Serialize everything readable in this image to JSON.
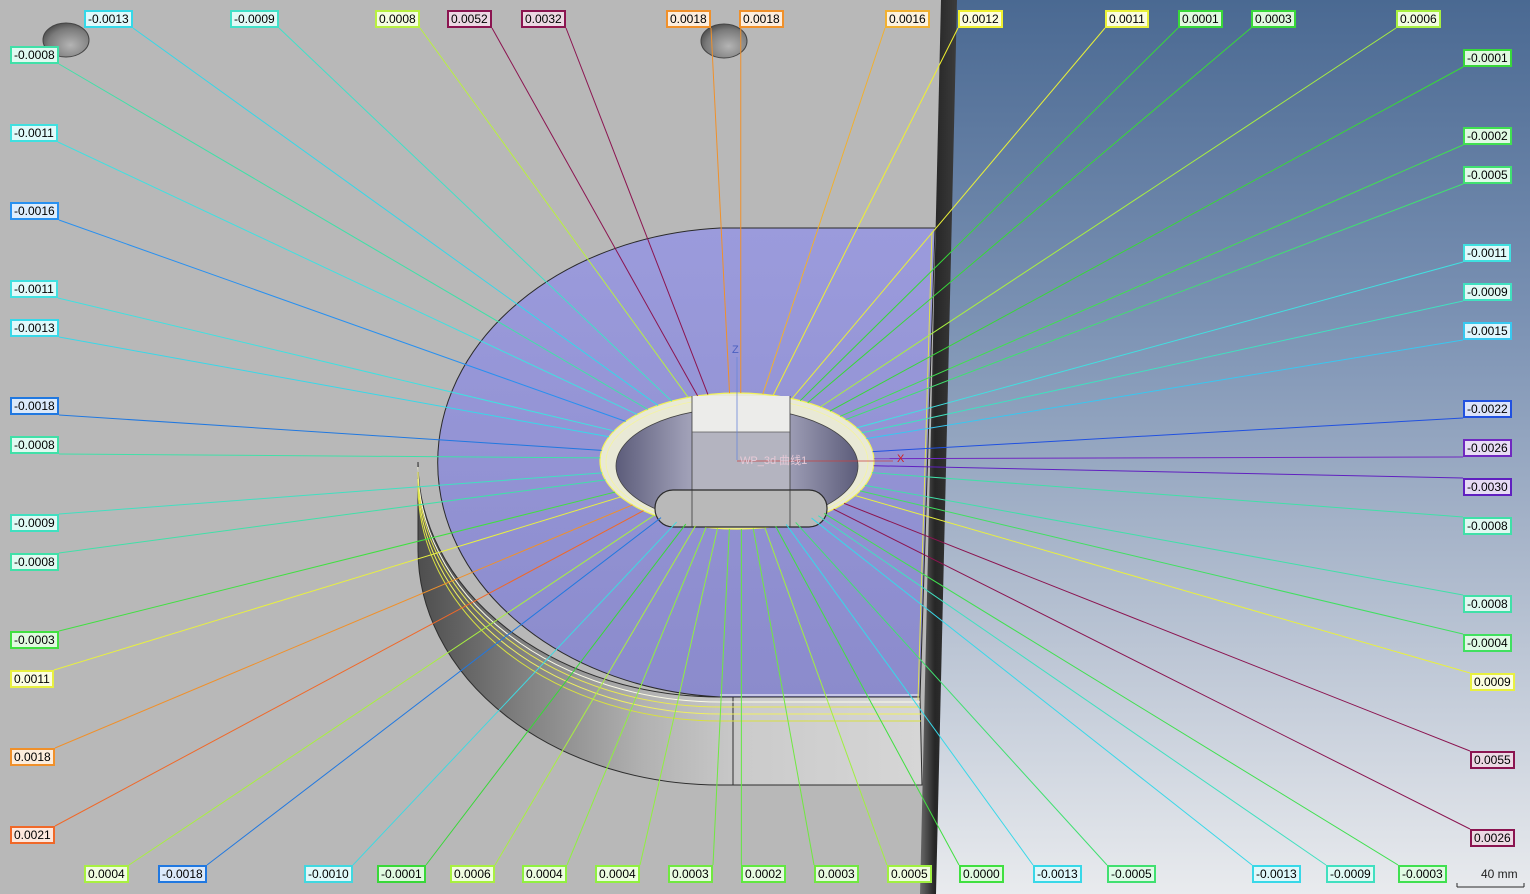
{
  "viewport": {
    "axis_z_label": "Z",
    "axis_x_label": "X",
    "workplane_label": "WP_3d 曲线1",
    "scale_label": "40 mm"
  },
  "deviation_labels": {
    "top": [
      {
        "value": "-0.0013",
        "color": "#34d8e8"
      },
      {
        "value": "-0.0009",
        "color": "#40e0c8"
      },
      {
        "value": "0.0008",
        "color": "#b8f040"
      },
      {
        "value": "0.0052",
        "color": "#8b1450"
      },
      {
        "value": "0.0032",
        "color": "#8b1450"
      },
      {
        "value": "0.0018",
        "color": "#f0902a"
      },
      {
        "value": "0.0018",
        "color": "#f0902a"
      },
      {
        "value": "0.0016",
        "color": "#f0b030"
      },
      {
        "value": "0.0012",
        "color": "#f0f030"
      },
      {
        "value": "0.0011",
        "color": "#e8f038"
      },
      {
        "value": "0.0001",
        "color": "#38d838"
      },
      {
        "value": "0.0003",
        "color": "#38d838"
      },
      {
        "value": "0.0006",
        "color": "#a8f040"
      }
    ],
    "left": [
      {
        "value": "-0.0008",
        "color": "#40e0a8"
      },
      {
        "value": "-0.0011",
        "color": "#40e0e0"
      },
      {
        "value": "-0.0016",
        "color": "#2890f0"
      },
      {
        "value": "-0.0011",
        "color": "#40e0e0"
      },
      {
        "value": "-0.0013",
        "color": "#38d8e8"
      },
      {
        "value": "-0.0018",
        "color": "#2078e0"
      },
      {
        "value": "-0.0008",
        "color": "#40e0a8"
      },
      {
        "value": "-0.0009",
        "color": "#40e0c0"
      },
      {
        "value": "-0.0008",
        "color": "#40e0a8"
      },
      {
        "value": "-0.0003",
        "color": "#40e040"
      },
      {
        "value": "0.0011",
        "color": "#e8f040"
      },
      {
        "value": "0.0018",
        "color": "#f0902a"
      },
      {
        "value": "0.0021",
        "color": "#f06828"
      }
    ],
    "right": [
      {
        "value": "-0.0001",
        "color": "#38d838"
      },
      {
        "value": "-0.0002",
        "color": "#40e050"
      },
      {
        "value": "-0.0005",
        "color": "#40e070"
      },
      {
        "value": "-0.0011",
        "color": "#40e0e0"
      },
      {
        "value": "-0.0009",
        "color": "#40e0c0"
      },
      {
        "value": "-0.0015",
        "color": "#38c8f0"
      },
      {
        "value": "-0.0022",
        "color": "#2050e0"
      },
      {
        "value": "-0.0026",
        "color": "#7028c0"
      },
      {
        "value": "-0.0030",
        "color": "#6020c0"
      },
      {
        "value": "-0.0008",
        "color": "#40e0a8"
      },
      {
        "value": "-0.0008",
        "color": "#40e0a8"
      },
      {
        "value": "-0.0004",
        "color": "#40e060"
      },
      {
        "value": "0.0009",
        "color": "#e8f040"
      },
      {
        "value": "0.0055",
        "color": "#8b1450"
      },
      {
        "value": "0.0026",
        "color": "#8b1450"
      }
    ],
    "bottom": [
      {
        "value": "0.0004",
        "color": "#a8f040"
      },
      {
        "value": "-0.0018",
        "color": "#2078e0"
      },
      {
        "value": "-0.0010",
        "color": "#40d8e0"
      },
      {
        "value": "-0.0001",
        "color": "#38d838"
      },
      {
        "value": "0.0006",
        "color": "#a8f040"
      },
      {
        "value": "0.0004",
        "color": "#90f040"
      },
      {
        "value": "0.0004",
        "color": "#90f040"
      },
      {
        "value": "0.0003",
        "color": "#70e840"
      },
      {
        "value": "0.0002",
        "color": "#60e840"
      },
      {
        "value": "0.0003",
        "color": "#70e840"
      },
      {
        "value": "0.0005",
        "color": "#a0f040"
      },
      {
        "value": "0.0000",
        "color": "#40e040"
      },
      {
        "value": "-0.0013",
        "color": "#38d8e8"
      },
      {
        "value": "-0.0005",
        "color": "#40e070"
      },
      {
        "value": "-0.0013",
        "color": "#38d8e8"
      },
      {
        "value": "-0.0009",
        "color": "#40e0c0"
      },
      {
        "value": "-0.0003",
        "color": "#40e050"
      }
    ]
  }
}
